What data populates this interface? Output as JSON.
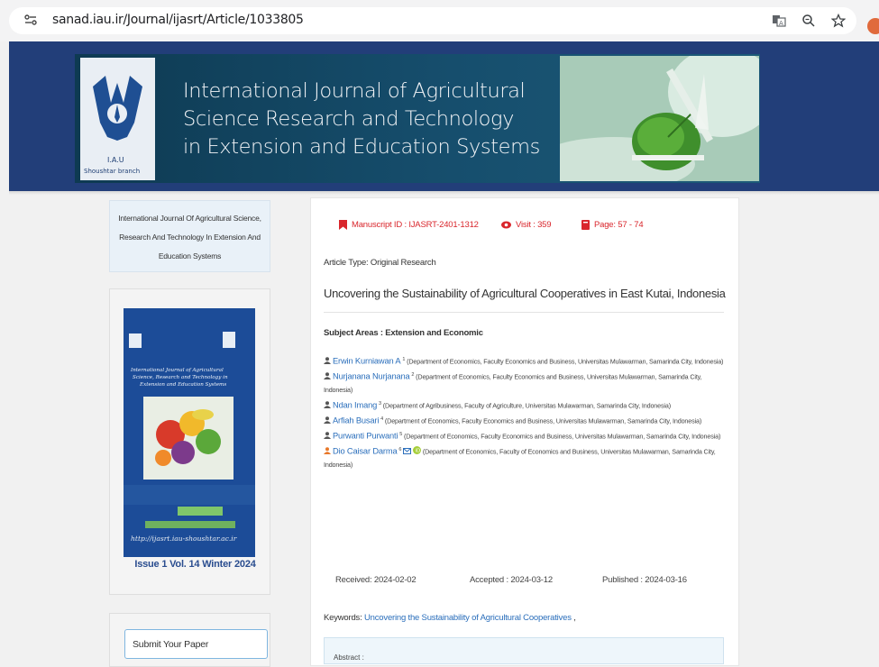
{
  "browser": {
    "url": "sanad.iau.ir/Journal/ijasrt/Article/1033805",
    "icons": [
      "site-info-icon",
      "translate-icon",
      "zoom-icon",
      "bookmark-star-icon",
      "profile-avatar"
    ]
  },
  "banner": {
    "logo_caption": "I.A.U",
    "logo_subcaption": "Shoushtar branch",
    "title_line1": "International Journal of Agricultural",
    "title_line2": "Science Research and Technology",
    "title_line3": "in Extension and Education  Systems"
  },
  "sidebar": {
    "journal_name": "International Journal Of Agricultural Science, Research And Technology In Extension And Education Systems",
    "issue_label": "Issue 1 Vol. 14 Winter 2024",
    "submit_label": "Submit Your Paper",
    "cover": {
      "title": "International Journal of Agricultural Science, Research and Technology in Extension and Education Systems",
      "url": "http://ijasrt.iau-shoushtar.ac.ir"
    }
  },
  "article": {
    "manuscript_id": "Manuscript ID : IJASRT-2401-1312",
    "visit": "Visit : 359",
    "page": "Page: 57 - 74",
    "article_type": "Article Type: Original Research",
    "title": "Uncovering the Sustainability of Agricultural Cooperatives in East Kutai, Indonesia",
    "subject": "Subject Areas : Extension and Economic",
    "authors": [
      {
        "name": "Erwin Kurniawan A",
        "sup": "1",
        "affiliation": "(Department of Economics, Faculty Economics and Business, Universitas Mulawarman, Samarinda City, Indonesia)"
      },
      {
        "name": "Nurjanana Nurjanana",
        "sup": "2",
        "affiliation": "(Department of Economics, Faculty Economics and Business, Universitas Mulawarman, Samarinda City, Indonesia)"
      },
      {
        "name": "Ndan Imang",
        "sup": "3",
        "affiliation": "(Department of Agribusiness, Faculty of Agriculture, Universitas Mulawarman, Samarinda City, Indonesia)"
      },
      {
        "name": "Arfiah Busari",
        "sup": "4",
        "affiliation": "(Department of Economics, Faculty Economics and Business, Universitas Mulawarman, Samarinda City, Indonesia)"
      },
      {
        "name": "Purwanti Purwanti",
        "sup": "5",
        "affiliation": "(Department of Economics, Faculty Economics and Business, Universitas Mulawarman, Samarinda City, Indonesia)"
      },
      {
        "name": "Dio Caisar Darma",
        "sup": "6",
        "affiliation": "(Department of Economics, Faculty of Economics and Business, Universitas Mulawarman, Samarinda City, Indonesia)"
      }
    ],
    "received": "Received: 2024-02-02",
    "accepted": "Accepted : 2024-03-12",
    "published": "Published : 2024-03-16",
    "keywords_label": "Keywords:",
    "keywords_value": "Uncovering the Sustainability of Agricultural Cooperatives",
    "keywords_trailing": ",",
    "abstract_label": "Abstract :"
  },
  "colors": {
    "banner_bg": "#223e79",
    "accent_red": "#d9262c",
    "link_blue": "#2a6ebb",
    "corresponding_author_icon": "#e8782a"
  }
}
